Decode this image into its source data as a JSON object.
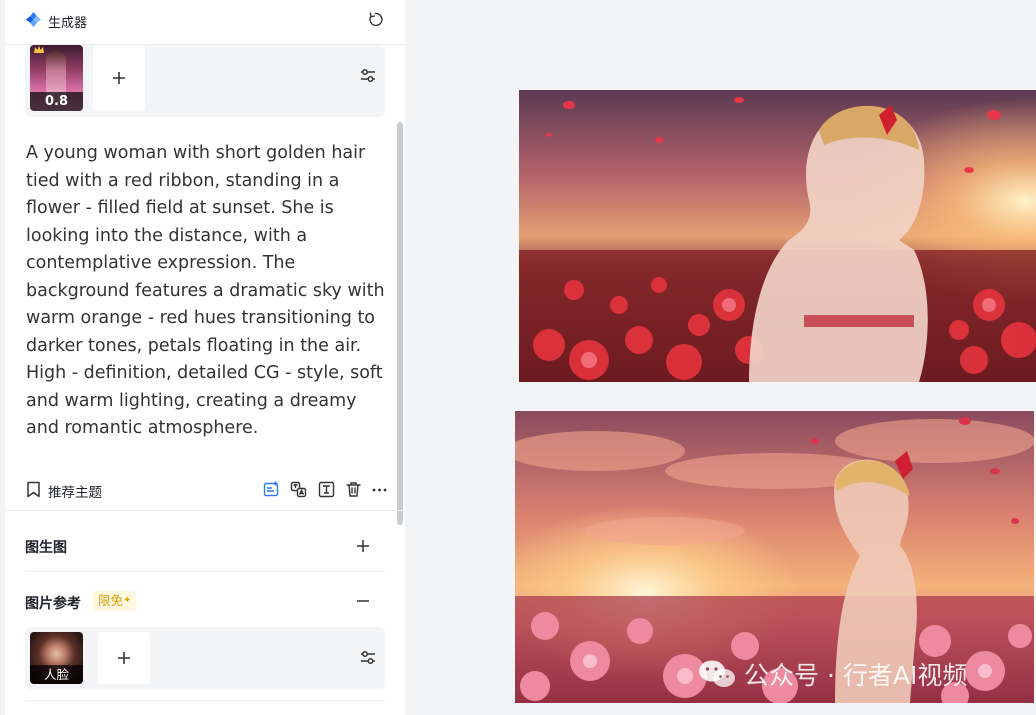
{
  "header": {
    "title": "生成器",
    "brand_icon": "generator-logo-icon",
    "refresh_icon": "refresh-icon"
  },
  "reference": {
    "weight": "0.8",
    "add_icon": "plus-icon",
    "settings_icon": "adjust-sliders-icon"
  },
  "prompt": {
    "text": "A young woman with short golden hair tied with a red ribbon, standing in a flower - filled field at sunset. She is looking into the distance, with a contemplative expression. The background features a dramatic sky with warm orange - red hues transitioning to darker tones, petals floating in the air. High - definition, detailed CG - style, soft and warm lighting, creating a dreamy and romantic atmosphere."
  },
  "actions": {
    "topic_label": "推荐主题",
    "icons": [
      "ai-edit-icon",
      "translate-icon",
      "expand-icon",
      "trash-icon",
      "more-icon"
    ]
  },
  "sections": {
    "img2img": {
      "title": "图生图",
      "toggle_icon": "plus-icon"
    },
    "image_reference": {
      "title": "图片参考",
      "badge": "限免",
      "toggle_icon": "minus-icon"
    }
  },
  "face_reference": {
    "label": "人脸",
    "add_icon": "plus-icon",
    "settings_icon": "adjust-sliders-icon"
  },
  "gallery": {
    "watermark": "公众号 · 行者AI视频"
  },
  "colors": {
    "accent": "#2b7cff",
    "badge_text": "#d4a017",
    "badge_bg": "#fff8e1"
  }
}
